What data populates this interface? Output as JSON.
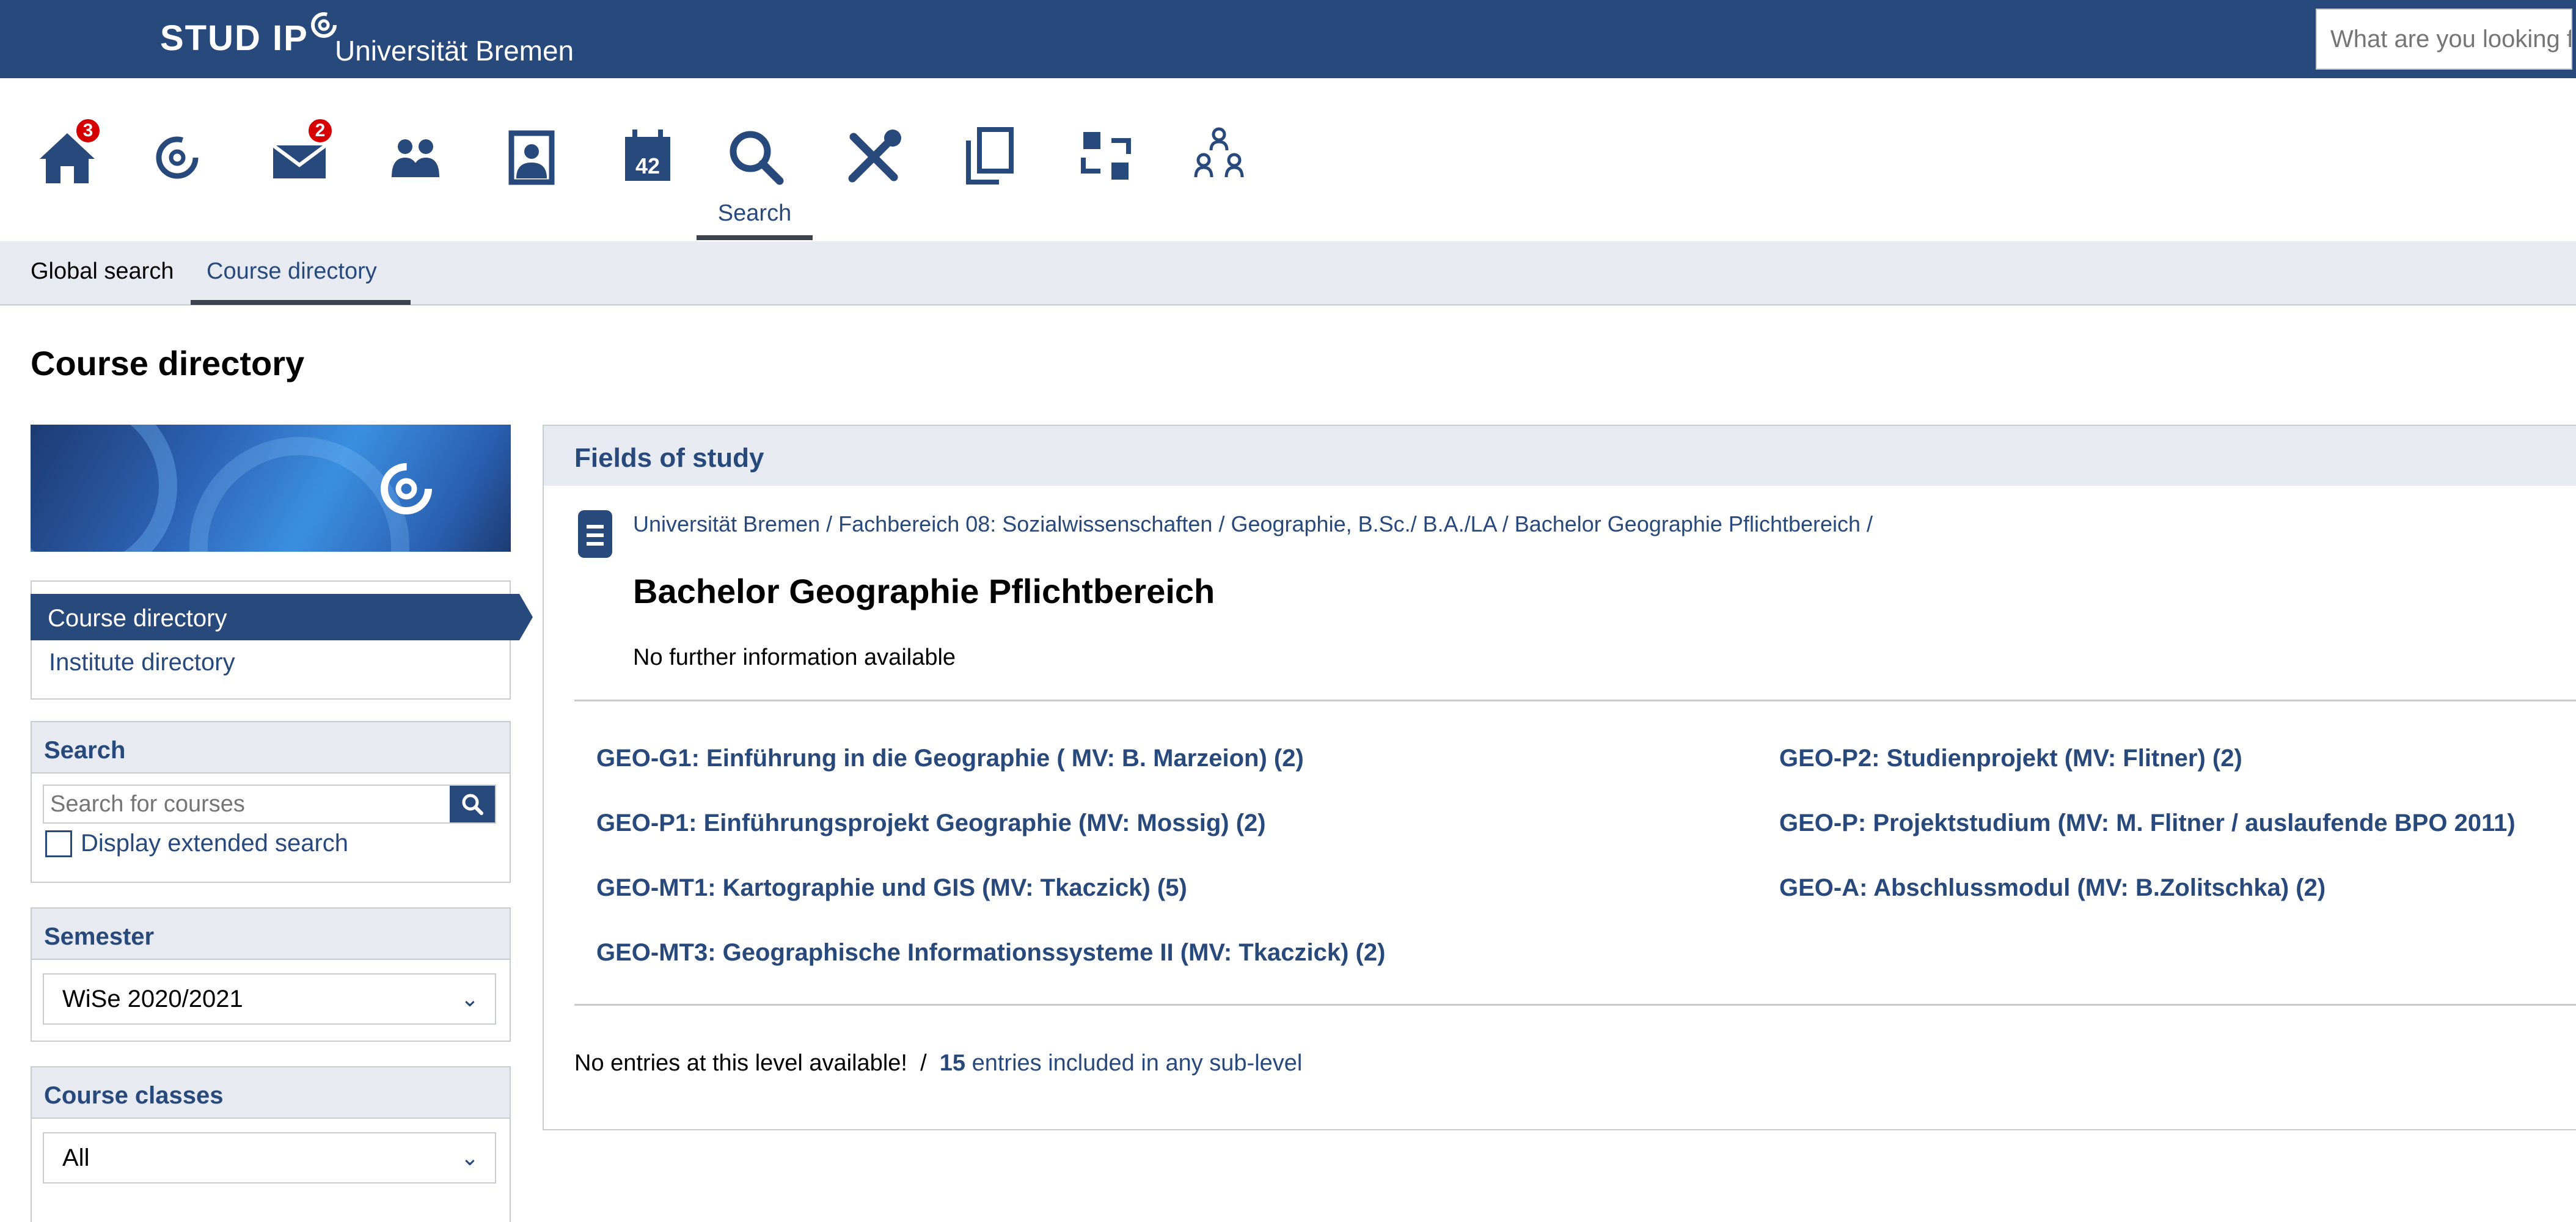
{
  "header": {
    "logo_text": "STUD IP",
    "institution": "Universität Bremen",
    "search_placeholder": "What are you looking for?"
  },
  "icon_nav": {
    "items": [
      {
        "icon": "home-icon",
        "badge": "3"
      },
      {
        "icon": "studip-logo-icon"
      },
      {
        "icon": "mail-icon",
        "badge": "2"
      },
      {
        "icon": "community-icon"
      },
      {
        "icon": "profile-icon"
      },
      {
        "icon": "calendar-icon",
        "calendar_day": "42"
      },
      {
        "icon": "search-icon",
        "label": "Search",
        "active": true
      },
      {
        "icon": "tools-icon"
      },
      {
        "icon": "files-icon"
      },
      {
        "icon": "exchange-icon"
      },
      {
        "icon": "hierarchy-icon"
      }
    ]
  },
  "tabs": [
    {
      "label": "Global search",
      "active": false
    },
    {
      "label": "Course directory",
      "active": true
    }
  ],
  "page_title": "Course directory",
  "sidebar": {
    "nav": {
      "active": "Course directory",
      "item": "Institute directory"
    },
    "search": {
      "title": "Search",
      "placeholder": "Search for courses",
      "extended_label": "Display extended search"
    },
    "semester": {
      "title": "Semester",
      "value": "WiSe 2020/2021"
    },
    "course_classes": {
      "title": "Course classes",
      "value": "All"
    }
  },
  "main": {
    "header": "Fields of study",
    "breadcrumb": "Universität Bremen / Fachbereich 08: Sozialwissenschaften / Geographie, B.Sc./ B.A./LA / Bachelor Geographie Pflichtbereich /",
    "title": "Bachelor Geographie Pflichtbereich",
    "info": "No further information available",
    "courses_left": [
      "GEO-G1: Einführung in die Geographie ( MV: B. Marzeion) (2)",
      "GEO-P1: Einführungsprojekt Geographie (MV: Mossig) (2)",
      "GEO-MT1: Kartographie und GIS (MV: Tkaczick) (5)",
      "GEO-MT3: Geographische Informationssysteme II (MV: Tkaczick) (2)"
    ],
    "courses_right": [
      "GEO-P2: Studienprojekt (MV: Flitner) (2)",
      "GEO-P: Projektstudium (MV: M. Flitner / auslaufende BPO 2011)",
      "GEO-A: Abschlussmodul (MV: B.Zolitschka) (2)"
    ],
    "footer": {
      "no_entries": "No entries at this level available!",
      "separator": "/",
      "count": "15",
      "sub_text": "entries included in any sub-level"
    }
  },
  "colors": {
    "brand": "#28497c",
    "badge": "#d60000",
    "panel": "#e7ebf1"
  }
}
